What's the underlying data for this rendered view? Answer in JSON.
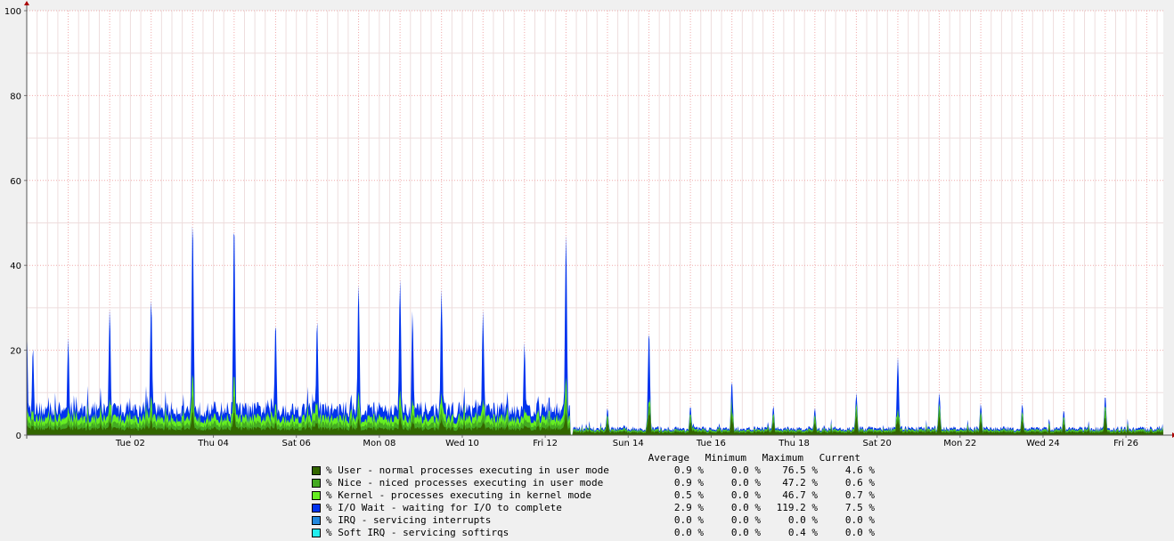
{
  "chart_data": {
    "type": "area",
    "stacked": true,
    "ylim": [
      0,
      100
    ],
    "yticks": [
      0,
      20,
      40,
      60,
      80,
      100
    ],
    "x_tick_labels": [
      "Tue 02",
      "Thu 04",
      "Sat 06",
      "Mon 08",
      "Wed 10",
      "Fri 12",
      "Sun 14",
      "Tue 16",
      "Thu 18",
      "Sat 20",
      "Mon 22",
      "Wed 24",
      "Fri 26"
    ],
    "grid": true,
    "legend_placement": "bottom",
    "legend_headers": [
      "Average",
      "Minimum",
      "Maximum",
      "Current"
    ],
    "series": [
      {
        "name": "% User - normal processes executing in user mode",
        "color": "#336600",
        "average": "0.9 %",
        "minimum": "0.0 %",
        "maximum": "76.5 %",
        "current": "4.6 %"
      },
      {
        "name": "% Nice - niced processes executing in user mode",
        "color": "#44aa22",
        "average": "0.9 %",
        "minimum": "0.0 %",
        "maximum": "47.2 %",
        "current": "0.6 %"
      },
      {
        "name": "% Kernel - processes executing in kernel mode",
        "color": "#66ee22",
        "average": "0.5 %",
        "minimum": "0.0 %",
        "maximum": "46.7 %",
        "current": "0.7 %"
      },
      {
        "name": "% I/O Wait - waiting for I/O to complete",
        "color": "#0033ee",
        "average": "2.9 %",
        "minimum": "0.0 %",
        "maximum": "119.2 %",
        "current": "7.5 %"
      },
      {
        "name": "% IRQ - servicing interrupts",
        "color": "#2288dd",
        "average": "0.0 %",
        "minimum": "0.0 %",
        "maximum": "0.0 %",
        "current": "0.0 %"
      },
      {
        "name": "% Soft IRQ - servicing softirqs",
        "color": "#22eeee",
        "average": "0.0 %",
        "minimum": "0.0 %",
        "maximum": "0.4 %",
        "current": "0.0 %"
      }
    ],
    "total_profile": {
      "x_unit": "days since start of plot",
      "x_range": [
        0,
        27.4
      ],
      "busy_period_end": 13.1,
      "busy_baseline": 6,
      "quiet_baseline": 1.5,
      "spikes": [
        [
          0.0,
          26
        ],
        [
          0.15,
          21
        ],
        [
          1.0,
          23
        ],
        [
          2.0,
          30
        ],
        [
          3.0,
          32.5
        ],
        [
          4.0,
          51.5
        ],
        [
          5.0,
          51
        ],
        [
          6.0,
          27
        ],
        [
          7.0,
          27.5
        ],
        [
          8.0,
          36
        ],
        [
          9.0,
          37
        ],
        [
          9.3,
          29.5
        ],
        [
          10.0,
          34.5
        ],
        [
          11.0,
          29.5
        ],
        [
          12.0,
          22
        ],
        [
          13.0,
          48
        ],
        [
          14.0,
          6.5
        ],
        [
          15.0,
          25
        ],
        [
          16.0,
          7
        ],
        [
          17.0,
          13
        ],
        [
          18.0,
          7
        ],
        [
          19.0,
          6.5
        ],
        [
          20.0,
          10
        ],
        [
          21.0,
          18.5
        ],
        [
          22.0,
          10
        ],
        [
          23.0,
          7.5
        ],
        [
          24.0,
          7.5
        ],
        [
          25.0,
          6
        ],
        [
          26.0,
          9.5
        ]
      ]
    }
  }
}
